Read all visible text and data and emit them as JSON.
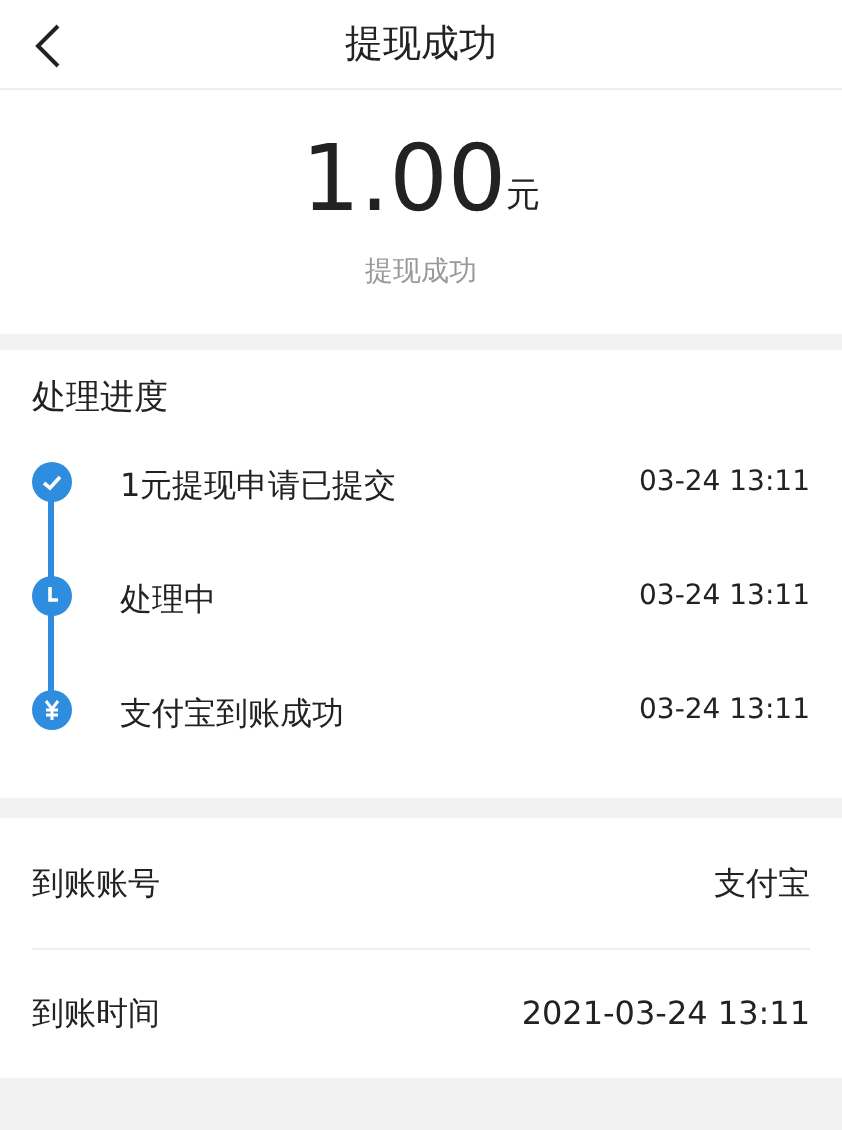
{
  "header": {
    "title": "提现成功"
  },
  "amount": {
    "value": "1.00",
    "unit": "元",
    "status": "提现成功"
  },
  "progress": {
    "title": "处理进度",
    "steps": [
      {
        "kind": "check",
        "label": "1元提现申请已提交",
        "time": "03-24 13:11"
      },
      {
        "kind": "clock",
        "label": "处理中",
        "time": "03-24 13:11"
      },
      {
        "kind": "yen",
        "label": "支付宝到账成功",
        "time": "03-24 13:11"
      }
    ]
  },
  "details": [
    {
      "label": "到账账号",
      "value": "支付宝"
    },
    {
      "label": "到账时间",
      "value": "2021-03-24 13:11"
    }
  ]
}
